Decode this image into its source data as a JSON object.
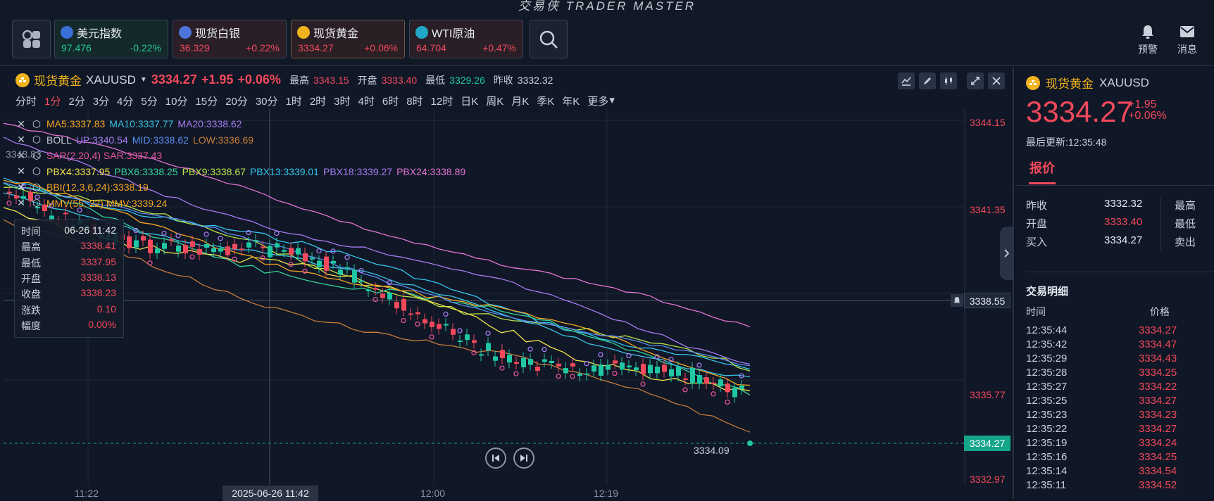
{
  "app": {
    "brand": "交易侠 TRADER MASTER"
  },
  "topbar": {
    "quotes": [
      {
        "name": "美元指数",
        "price": "97.476",
        "change": "-0.22%",
        "dir": "down",
        "icon": "us-flag-icon"
      },
      {
        "name": "现货白银",
        "price": "36.329",
        "change": "+0.22%",
        "dir": "up",
        "icon": "silver-icon"
      },
      {
        "name": "现货黄金",
        "price": "3334.27",
        "change": "+0.06%",
        "dir": "up",
        "icon": "gold-icon"
      },
      {
        "name": "WTI原油",
        "price": "64.704",
        "change": "+0.47%",
        "dir": "up",
        "icon": "oil-icon"
      }
    ],
    "alert_label": "预警",
    "message_label": "消息"
  },
  "chart": {
    "title": "现货黄金",
    "symbol": "XAUUSD",
    "price": "3334.27",
    "change": "+1.95",
    "change_pct": "+0.06%",
    "high_label": "最高",
    "high": "3343.15",
    "open_label": "开盘",
    "open": "3333.40",
    "low_label": "最低",
    "low": "3329.26",
    "prev_label": "昨收",
    "prev": "3332.32",
    "periods": [
      "分时",
      "1分",
      "2分",
      "3分",
      "4分",
      "5分",
      "10分",
      "15分",
      "20分",
      "30分",
      "1时",
      "2时",
      "3时",
      "4时",
      "6时",
      "8时",
      "12时",
      "日K",
      "周K",
      "月K",
      "季K",
      "年K",
      "更多"
    ],
    "active_period": "1分",
    "indicators": [
      [
        {
          "t": "MA5:3337.83",
          "c": "#f5a623"
        },
        {
          "t": "MA10:3337.77",
          "c": "#39c4e6"
        },
        {
          "t": "MA20:3338.62",
          "c": "#a77cf2"
        }
      ],
      [
        {
          "t": "BOLL",
          "c": "#c9d1dc"
        },
        {
          "t": "UP:3340.54",
          "c": "#a77cf2"
        },
        {
          "t": "MID:3338.62",
          "c": "#5b8cf0"
        },
        {
          "t": "LOW:3336.69",
          "c": "#c97b3a"
        }
      ],
      [
        {
          "t": "SAR(2,20,4) SAR:3337.43",
          "c": "#e8559a"
        }
      ],
      [
        {
          "t": "PBX4:3337.95",
          "c": "#f2e14c"
        },
        {
          "t": "PBX6:3338.25",
          "c": "#36d39a"
        },
        {
          "t": "PBX9:3338.67",
          "c": "#b9e34a"
        },
        {
          "t": "PBX13:3339.01",
          "c": "#33c8f0"
        },
        {
          "t": "PBX18:3339.27",
          "c": "#a77cf2"
        },
        {
          "t": "PBX24:3338.89",
          "c": "#e473d6"
        }
      ],
      [
        {
          "t": "BBI(12,3,6,24):3338.19",
          "c": "#f5a623"
        }
      ],
      [
        {
          "t": "MMV(55, 22) MMV:3339.24",
          "c": "#f5a623"
        }
      ]
    ],
    "left_price_label": "3343.83",
    "price_axis": [
      "3344.15",
      "3341.35",
      "3335.77",
      "3332.97"
    ],
    "crosshair_price": "3338.55",
    "current_price_tag": "3334.27",
    "low_marker": "3334.09",
    "time_axis": [
      "11:22",
      "12:00",
      "12:19"
    ],
    "crosshair_date": "2025-06-26 11:42",
    "tooltip": [
      {
        "k": "时间",
        "v": "06-26 11:42",
        "c": "#e6ebf2"
      },
      {
        "k": "最高",
        "v": "3338.41",
        "c": "#f2495c"
      },
      {
        "k": "最低",
        "v": "3337.95",
        "c": "#f2495c"
      },
      {
        "k": "开盘",
        "v": "3338.13",
        "c": "#f2495c"
      },
      {
        "k": "收盘",
        "v": "3338.23",
        "c": "#f2495c"
      },
      {
        "k": "涨跌",
        "v": "0.10",
        "c": "#f2495c"
      },
      {
        "k": "幅度",
        "v": "0.00%",
        "c": "#f2495c"
      }
    ]
  },
  "quote_panel": {
    "title": "现货黄金",
    "symbol": "XAUUSD",
    "price": "3334.27",
    "change": "+1.95",
    "change_pct": "+0.06%",
    "updated": "最后更新:12:35:48",
    "tab": "报价",
    "stats": [
      {
        "k": "昨收",
        "v": "3332.32",
        "c": "#e6ebf2"
      },
      {
        "k": "开盘",
        "v": "3333.40",
        "c": "#f2495c"
      },
      {
        "k": "买入",
        "v": "3334.27",
        "c": "#e6ebf2"
      }
    ],
    "stats_right": [
      "最高",
      "最低",
      "卖出"
    ],
    "trades_title": "交易明细",
    "col_time": "时间",
    "col_price": "价格",
    "trades": [
      {
        "t": "12:35:44",
        "p": "3334.27"
      },
      {
        "t": "12:35:42",
        "p": "3334.47"
      },
      {
        "t": "12:35:29",
        "p": "3334.43"
      },
      {
        "t": "12:35:28",
        "p": "3334.25"
      },
      {
        "t": "12:35:27",
        "p": "3334.22"
      },
      {
        "t": "12:35:25",
        "p": "3334.27"
      },
      {
        "t": "12:35:23",
        "p": "3334.23"
      },
      {
        "t": "12:35:22",
        "p": "3334.27"
      },
      {
        "t": "12:35:19",
        "p": "3334.24"
      },
      {
        "t": "12:35:16",
        "p": "3334.25"
      },
      {
        "t": "12:35:14",
        "p": "3334.54"
      },
      {
        "t": "12:35:11",
        "p": "3334.52"
      }
    ]
  }
}
